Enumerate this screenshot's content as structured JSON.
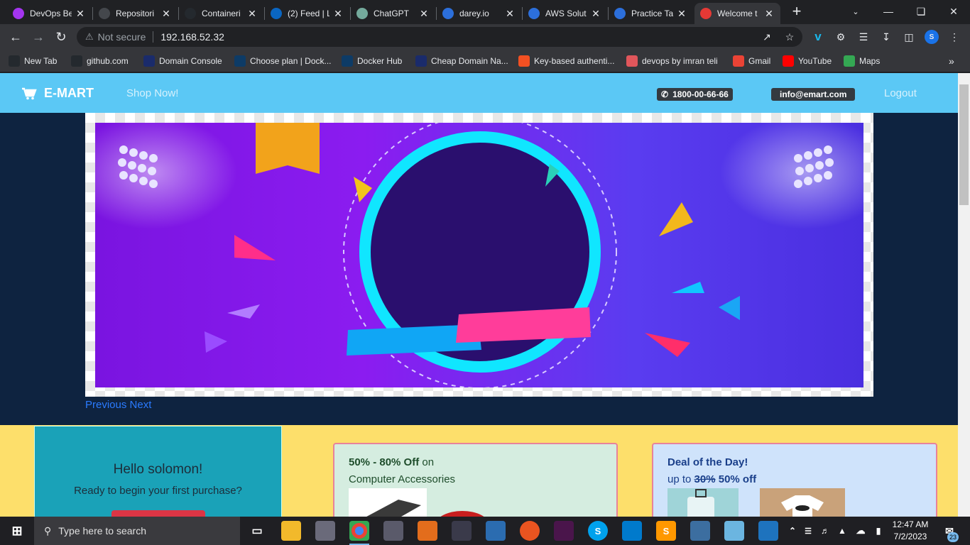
{
  "tabs": [
    {
      "title": "DevOps Be",
      "icon": "udemy-icon",
      "color": "#a435f0"
    },
    {
      "title": "Repositori",
      "icon": "repo-icon",
      "color": "#44474c"
    },
    {
      "title": "Containeri",
      "icon": "github-icon",
      "color": "#24292e"
    },
    {
      "title": "(2) Feed | L",
      "icon": "linkedin-icon",
      "color": "#0a66c2"
    },
    {
      "title": "ChatGPT",
      "icon": "chatgpt-icon",
      "color": "#74aa9c"
    },
    {
      "title": "darey.io",
      "icon": "darey-icon",
      "color": "#2c6fdb"
    },
    {
      "title": "AWS Solut",
      "icon": "darey-icon",
      "color": "#2c6fdb"
    },
    {
      "title": "Practice Ta",
      "icon": "darey-icon",
      "color": "#2c6fdb"
    },
    {
      "title": "Welcome t",
      "icon": "cart-icon",
      "color": "#e53935",
      "active": true
    }
  ],
  "address": {
    "security": "Not secure",
    "url": "192.168.52.32"
  },
  "profile_initial": "S",
  "bookmarks": [
    {
      "label": "New Tab",
      "icon": "github-icon",
      "color": "#24292e"
    },
    {
      "label": "github.com",
      "icon": "github-icon",
      "color": "#24292e"
    },
    {
      "label": "Domain Console",
      "icon": "domain-icon",
      "color": "#1a2b6b"
    },
    {
      "label": "Choose plan | Dock...",
      "icon": "docker-icon",
      "color": "#0d3b66"
    },
    {
      "label": "Docker Hub",
      "icon": "docker-icon",
      "color": "#0d3b66"
    },
    {
      "label": "Cheap Domain Na...",
      "icon": "domain-icon",
      "color": "#1a2b6b"
    },
    {
      "label": "Key-based authenti...",
      "icon": "microsoft-icon",
      "color": "#f25022"
    },
    {
      "label": "devops by imran teli",
      "icon": "circle-icon",
      "color": "#e0565b"
    },
    {
      "label": "Gmail",
      "icon": "gmail-icon",
      "color": "#ea4335"
    },
    {
      "label": "YouTube",
      "icon": "youtube-icon",
      "color": "#ff0000"
    },
    {
      "label": "Maps",
      "icon": "maps-icon",
      "color": "#34a853"
    }
  ],
  "site": {
    "brand": "E-MART",
    "shop_now": "Shop Now!",
    "phone": "1800-00-66-66",
    "email": "info@emart.com",
    "logout": "Logout",
    "carousel_prev": "Previous",
    "carousel_next": "Next",
    "hello_title": "Hello solomon!",
    "hello_sub": "Ready to begin your first purchase?",
    "card1": {
      "highlight": "50% - 80% Off",
      "rest": " on",
      "line2": "Computer Accessories"
    },
    "card2": {
      "title": "Deal of the Day!",
      "prefix": "up to ",
      "old": "30%",
      "new": " 50% off"
    }
  },
  "taskbar": {
    "search_placeholder": "Type here to search",
    "time": "12:47 AM",
    "date": "7/2/2023",
    "notifications": "23"
  }
}
